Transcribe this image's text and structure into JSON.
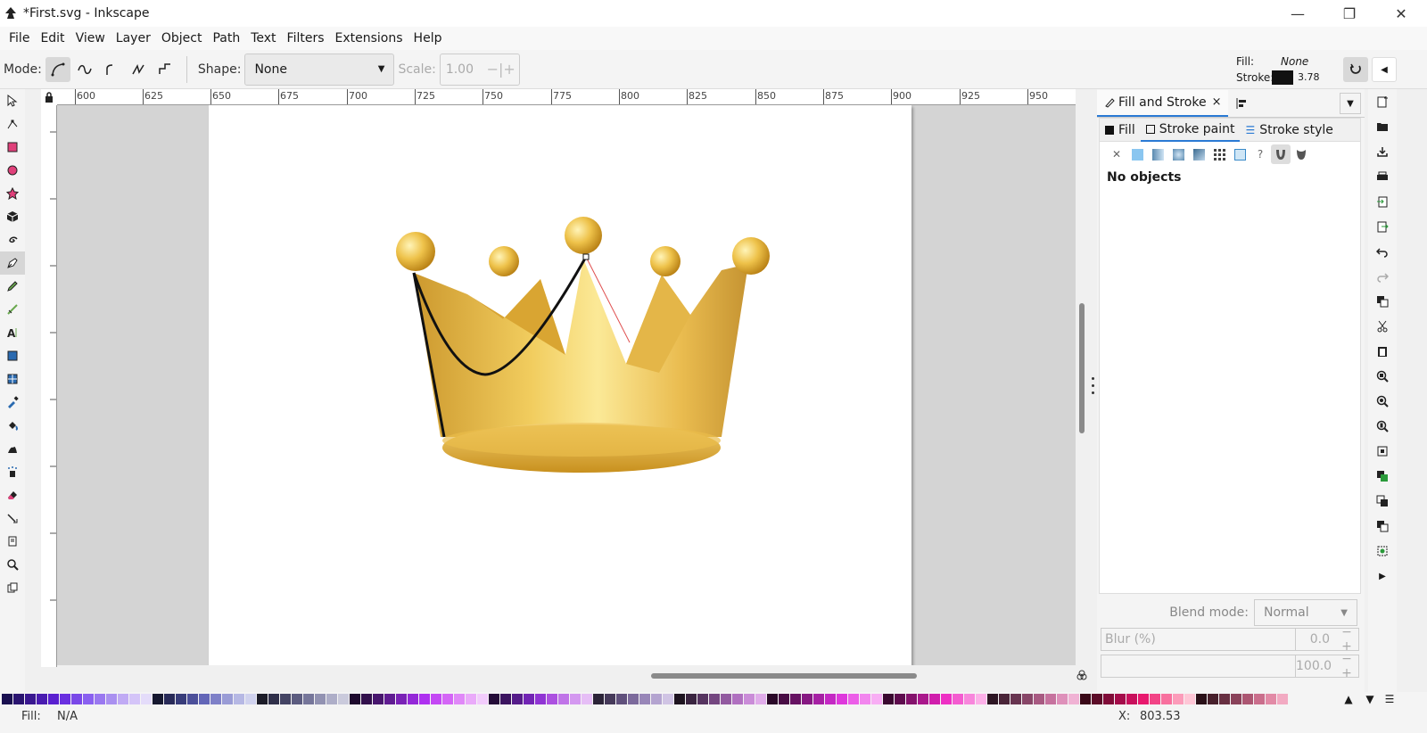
{
  "window": {
    "title": "*First.svg - Inkscape"
  },
  "menu": [
    "File",
    "Edit",
    "View",
    "Layer",
    "Object",
    "Path",
    "Text",
    "Filters",
    "Extensions",
    "Help"
  ],
  "toolbar": {
    "mode_label": "Mode:",
    "shape_label": "Shape:",
    "shape_value": "None",
    "scale_label": "Scale:",
    "scale_value": "1.00"
  },
  "style_indicator": {
    "fill_label": "Fill:",
    "fill_value": "None",
    "stroke_label": "Stroke:",
    "stroke_width": "3.78",
    "stroke_color": "#111111"
  },
  "ruler": {
    "labels": [
      "600",
      "625",
      "650",
      "675",
      "700",
      "725",
      "750",
      "775",
      "800",
      "825",
      "850",
      "875",
      "900",
      "925",
      "950"
    ]
  },
  "dock": {
    "tab_label": "Fill and Stroke",
    "tab_close": "×",
    "fs_tabs": [
      "Fill",
      "Stroke paint",
      "Stroke style"
    ],
    "no_objects": "No objects",
    "blend_label": "Blend mode:",
    "blend_value": "Normal",
    "blur_label": "Blur (%)",
    "blur_value": "0.0",
    "opacity_value": "100.0"
  },
  "status": {
    "fill_label": "Fill:",
    "fill_value": "N/A",
    "x_label": "X:",
    "x_value": "803.53"
  },
  "palette_colors": [
    "#1a1050",
    "#2a1470",
    "#3a1890",
    "#4a1cb0",
    "#5a20d0",
    "#6a30e0",
    "#7a48e8",
    "#8a60f0",
    "#9a78f0",
    "#aa90f0",
    "#c0aaf4",
    "#d4c4f8",
    "#e4dcfa",
    "#161830",
    "#282a58",
    "#383c7a",
    "#4c4f9a",
    "#6366b8",
    "#7e80c8",
    "#9a9cd6",
    "#b6b8e4",
    "#d0d2ee",
    "#1c1c28",
    "#30304a",
    "#444464",
    "#5c5c80",
    "#76769a",
    "#9292b2",
    "#aeaec8",
    "#cacadc",
    "#1e0a2e",
    "#32104c",
    "#48166e",
    "#601c92",
    "#7a22b6",
    "#9428d8",
    "#ae30f0",
    "#c448f4",
    "#d466f6",
    "#e088f8",
    "#eaaafa",
    "#f2ccfc",
    "#240c38",
    "#3c1460",
    "#561c8a",
    "#7224b4",
    "#9034d4",
    "#ac50e0",
    "#c074e8",
    "#d498f0",
    "#e6bef6",
    "#2c2438",
    "#463a5a",
    "#60507c",
    "#7c6a9c",
    "#9886b8",
    "#b4a4d0",
    "#d0c4e4",
    "#1e1420",
    "#3a2440",
    "#563460",
    "#744680",
    "#925aa0",
    "#b070c0",
    "#ca8cd8",
    "#e0acea",
    "#2a0828",
    "#480c44",
    "#661262",
    "#861882",
    "#a620a4",
    "#c428c4",
    "#de38dc",
    "#ec5ee8",
    "#f286ee",
    "#f8aef4",
    "#3a0830",
    "#5e0c4e",
    "#84126c",
    "#aa188c",
    "#d01eac",
    "#ee30c4",
    "#f45cd0",
    "#f886dc",
    "#fcb0e8",
    "#2e1624",
    "#4a2438",
    "#683450",
    "#884668",
    "#a85a82",
    "#c6729e",
    "#de90ba",
    "#f0b2d4",
    "#3a0818",
    "#5c0c28",
    "#800c38",
    "#a40c4a",
    "#c8105c",
    "#e8186e",
    "#f24486",
    "#f8709e",
    "#fc9cba",
    "#fec6d6",
    "#2a1018",
    "#48202c",
    "#683042",
    "#8a425a",
    "#ac5672",
    "#ca6e8c",
    "#e28aa6",
    "#f2aac2"
  ]
}
